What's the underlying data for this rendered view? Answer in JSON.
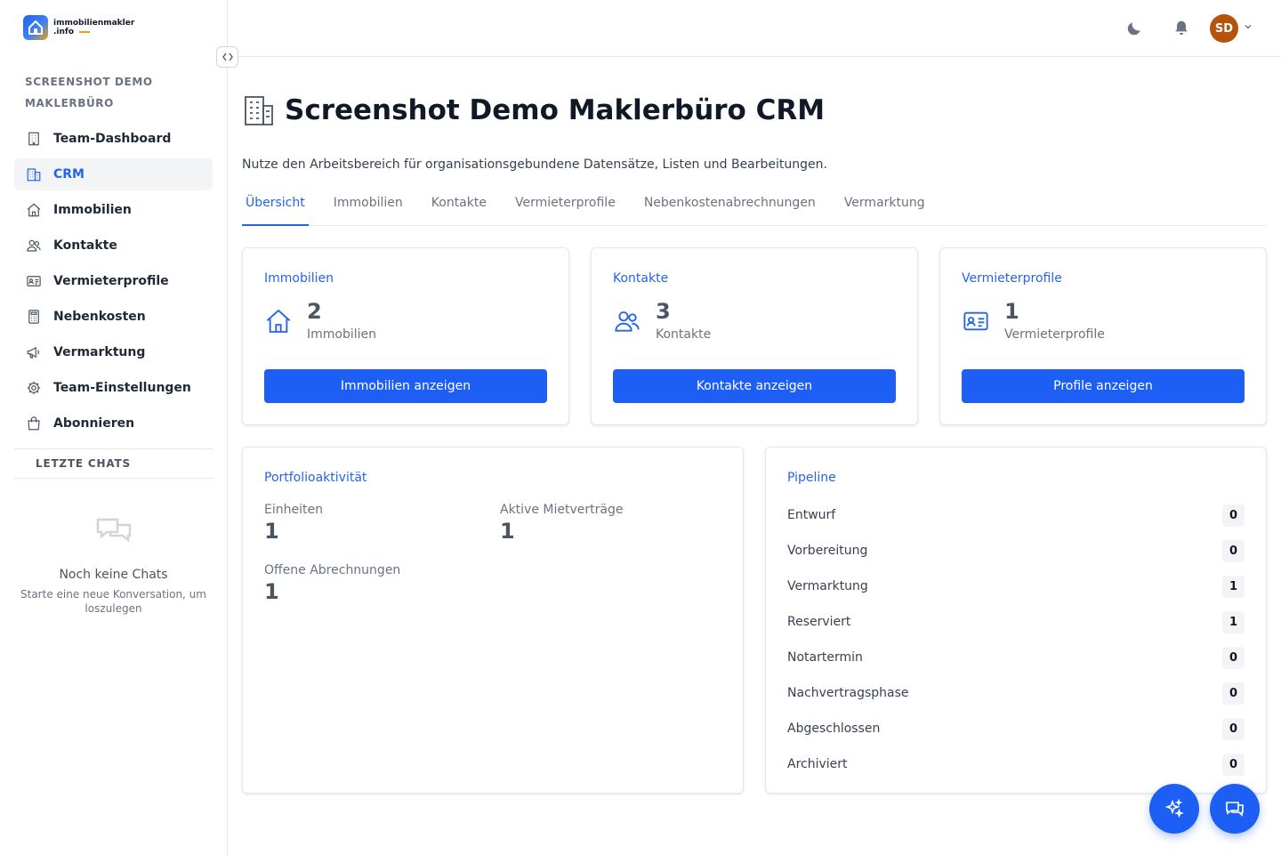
{
  "brand": {
    "line1": "immobilienmakler",
    "line2": ".info"
  },
  "org_name": "SCREENSHOT DEMO MAKLERBÜRO",
  "nav": [
    {
      "label": "Team-Dashboard",
      "icon": "building-icon"
    },
    {
      "label": "CRM",
      "icon": "buildings-icon"
    },
    {
      "label": "Immobilien",
      "icon": "home-icon"
    },
    {
      "label": "Kontakte",
      "icon": "users-icon"
    },
    {
      "label": "Vermieterprofile",
      "icon": "id-card-icon"
    },
    {
      "label": "Nebenkosten",
      "icon": "calculator-icon"
    },
    {
      "label": "Vermarktung",
      "icon": "megaphone-icon"
    },
    {
      "label": "Team-Einstellungen",
      "icon": "gear-icon"
    },
    {
      "label": "Abonnieren",
      "icon": "shopping-bag-icon"
    }
  ],
  "chats": {
    "heading": "LETZTE CHATS",
    "empty_title": "Noch keine Chats",
    "empty_hint": "Starte eine neue Konversation, um loszulegen"
  },
  "user": {
    "initials": "SD",
    "avatar_color": "#b45309"
  },
  "page": {
    "title": "Screenshot Demo Maklerbüro CRM",
    "subtitle": "Nutze den Arbeitsbereich für organisationsgebundene Datensätze, Listen und Bearbeitungen."
  },
  "tabs": [
    {
      "label": "Übersicht",
      "active": true
    },
    {
      "label": "Immobilien"
    },
    {
      "label": "Kontakte"
    },
    {
      "label": "Vermieterprofile"
    },
    {
      "label": "Nebenkostenabrechnungen"
    },
    {
      "label": "Vermarktung"
    }
  ],
  "stats": [
    {
      "title": "Immobilien",
      "value": "2",
      "label": "Immobilien",
      "button": "Immobilien anzeigen",
      "icon": "home-icon"
    },
    {
      "title": "Kontakte",
      "value": "3",
      "label": "Kontakte",
      "button": "Kontakte anzeigen",
      "icon": "users-icon"
    },
    {
      "title": "Vermieterprofile",
      "value": "1",
      "label": "Vermieterprofile",
      "button": "Profile anzeigen",
      "icon": "id-card-icon"
    }
  ],
  "portfolio": {
    "title": "Portfolioaktivität",
    "items": [
      {
        "label": "Einheiten",
        "value": "1"
      },
      {
        "label": "Aktive Mietverträge",
        "value": "1"
      },
      {
        "label": "Offene Abrechnungen",
        "value": "1"
      }
    ]
  },
  "pipeline": {
    "title": "Pipeline",
    "rows": [
      {
        "label": "Entwurf",
        "count": "0"
      },
      {
        "label": "Vorbereitung",
        "count": "0"
      },
      {
        "label": "Vermarktung",
        "count": "1"
      },
      {
        "label": "Reserviert",
        "count": "1"
      },
      {
        "label": "Notartermin",
        "count": "0"
      },
      {
        "label": "Nachvertragsphase",
        "count": "0"
      },
      {
        "label": "Abgeschlossen",
        "count": "0"
      },
      {
        "label": "Archiviert",
        "count": "0"
      }
    ]
  },
  "colors": {
    "accent": "#2563eb",
    "button": "#1d5ff5",
    "logo_accent": "#f59e0b"
  }
}
